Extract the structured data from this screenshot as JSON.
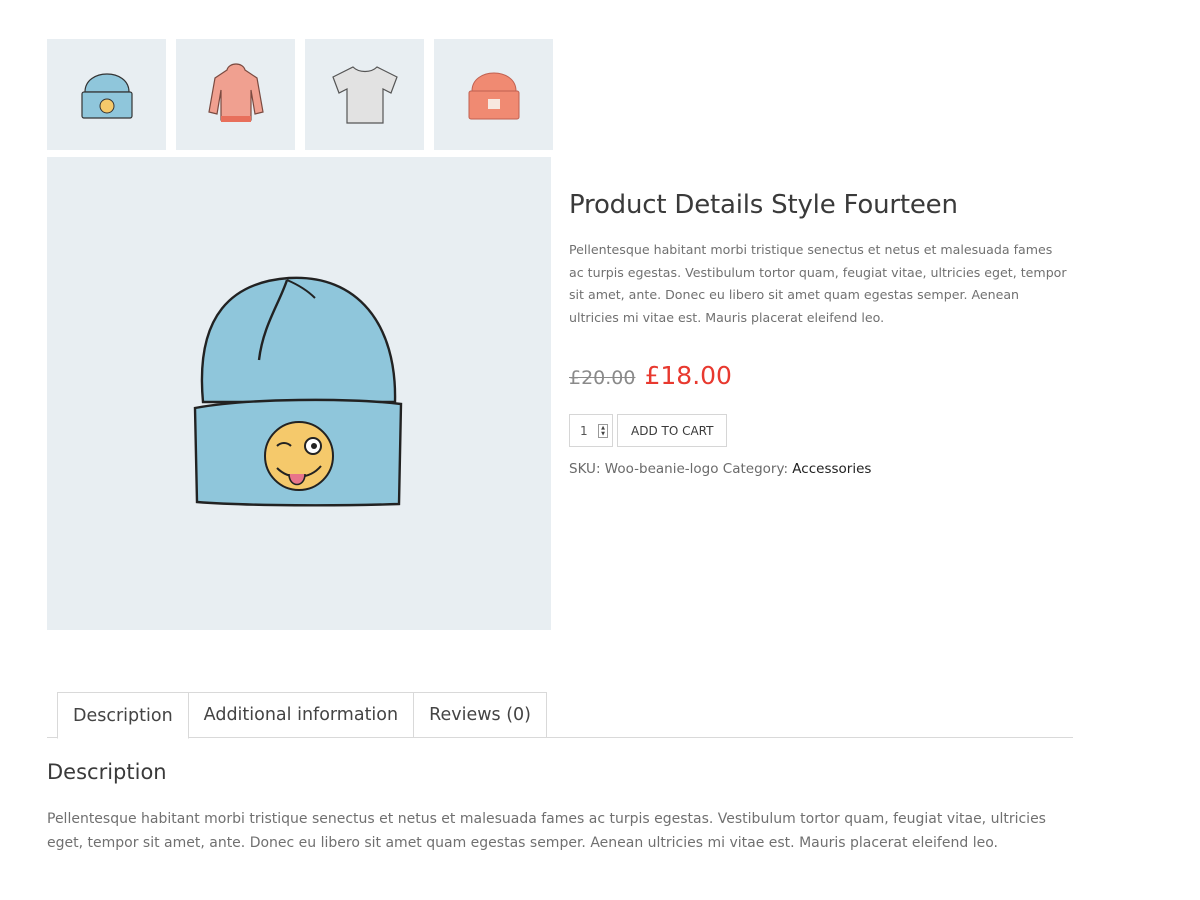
{
  "gallery": {
    "thumbnails": [
      {
        "icon": "blue-beanie-logo-icon"
      },
      {
        "icon": "hoodie-icon"
      },
      {
        "icon": "tshirt-icon"
      },
      {
        "icon": "red-beanie-icon"
      }
    ],
    "main_image_icon": "blue-beanie-logo-icon"
  },
  "product": {
    "title": "Product Details Style Fourteen",
    "short_description": "Pellentesque habitant morbi tristique senectus et netus et malesuada fames ac turpis egestas. Vestibulum tortor quam, feugiat vitae, ultricies eget, tempor sit amet, ante. Donec eu libero sit amet quam egestas semper. Aenean ultricies mi vitae est. Mauris placerat eleifend leo.",
    "price_old": "£20.00",
    "price_new": "£18.00",
    "quantity": "1",
    "add_to_cart_label": "ADD TO CART",
    "sku_label": "SKU:",
    "sku_value": "Woo-beanie-logo",
    "category_label": "Category:",
    "category_value": "Accessories"
  },
  "colors": {
    "sale_price": "#e8392f",
    "image_background": "#e8eef2",
    "beanie_blue": "#8fc6db",
    "hoodie_pink": "#f0a090",
    "beanie_red": "#f08a72"
  },
  "tabs": [
    {
      "label": "Description",
      "active": true
    },
    {
      "label": "Additional information",
      "active": false
    },
    {
      "label": "Reviews (0)",
      "active": false
    }
  ],
  "description": {
    "heading": "Description",
    "body": "Pellentesque habitant morbi tristique senectus et netus et malesuada fames ac turpis egestas. Vestibulum tortor quam, feugiat vitae, ultricies eget, tempor sit amet, ante. Donec eu libero sit amet quam egestas semper. Aenean ultricies mi vitae est. Mauris placerat eleifend leo."
  }
}
